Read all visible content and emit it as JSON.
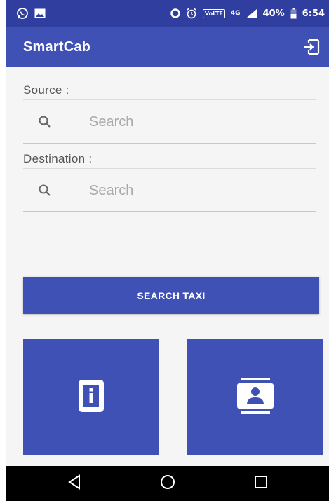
{
  "status_bar": {
    "network": "4G",
    "volte": "VoLTE",
    "battery": "40%",
    "time": "6:54",
    "icons": [
      "whatsapp-icon",
      "image-icon",
      "data-saver-icon",
      "alarm-icon",
      "signal-icon",
      "battery-icon"
    ]
  },
  "appbar": {
    "title": "SmartCab",
    "action_icon": "logout-icon"
  },
  "source": {
    "label": "Source :",
    "placeholder": "Search"
  },
  "destination": {
    "label": "Destination :",
    "placeholder": "Search"
  },
  "search_button": {
    "label": "SEARCH TAXI"
  },
  "tiles": [
    {
      "icon": "info-device-icon"
    },
    {
      "icon": "contact-card-icon"
    }
  ],
  "nav_bar": {
    "buttons": [
      "back-icon",
      "home-icon",
      "recents-icon"
    ]
  },
  "colors": {
    "primary": "#3f51b5",
    "primary_dark": "#303f9f",
    "background": "#f5f5f5"
  }
}
